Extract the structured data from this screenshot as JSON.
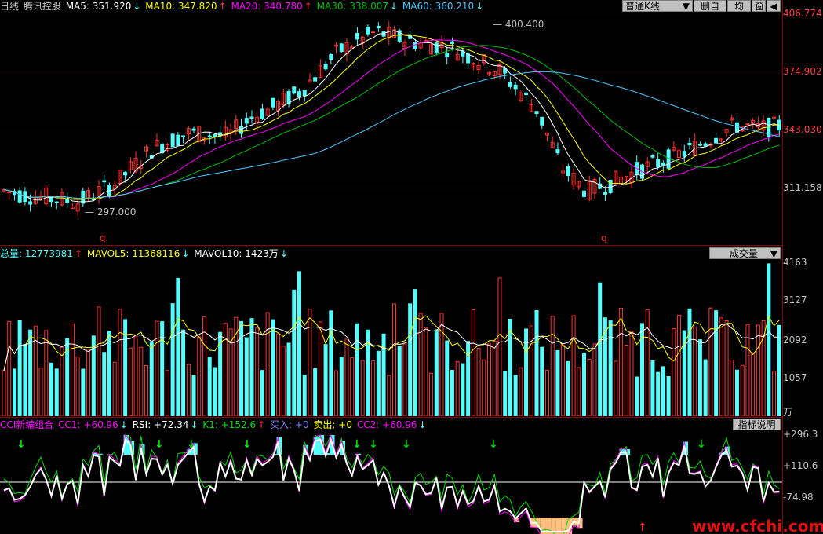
{
  "header": {
    "period": "日线",
    "stock_name": "腾讯控股",
    "ma5": "MA5: 351.920",
    "ma10": "MA10: 347.820",
    "ma20": "MA20: 340.780",
    "ma30": "MA30: 338.007",
    "ma60": "MA60: 360.210",
    "arrow_down": "↓",
    "arrow_up": "↑"
  },
  "toolbar": {
    "kline_select": "普通K线",
    "delete_watch": "删自选",
    "ma_lines": "均线",
    "window": "窗",
    "prev": "◀"
  },
  "price_axis": [
    "406.774",
    "374.902",
    "343.030",
    "311.158"
  ],
  "price_annotations": {
    "high": "400.400",
    "low": "297.000",
    "marker": "q"
  },
  "volume_header": {
    "total": "总量: 12773981",
    "mavol5": "MAVOL5: 11368116",
    "mavol10": "MAVOL10: 1423万",
    "select": "成交量"
  },
  "volume_axis": [
    "4163",
    "3127",
    "2092",
    "1057",
    "万"
  ],
  "indicator_header": {
    "name": "CCI新编组合",
    "cc1": "CC1: +60.96",
    "rsi": "RSI: +72.34",
    "k1": "K1: +152.6",
    "buy": "买入: +0",
    "sell": "卖出: +0",
    "cc2": "CC2: +60.96",
    "help_button": "指标说明"
  },
  "indicator_axis": [
    "+296.3",
    "+110.6",
    "-74.98"
  ],
  "watermark": "www.cfchi.com",
  "colors": {
    "up": "#ff3232",
    "down": "#54ffff",
    "ma5": "#ffffff",
    "ma10": "#ffff00",
    "ma20": "#ff00ff",
    "ma30": "#00c000",
    "ma60": "#4fc8ff",
    "axis": "#8a0000"
  }
}
